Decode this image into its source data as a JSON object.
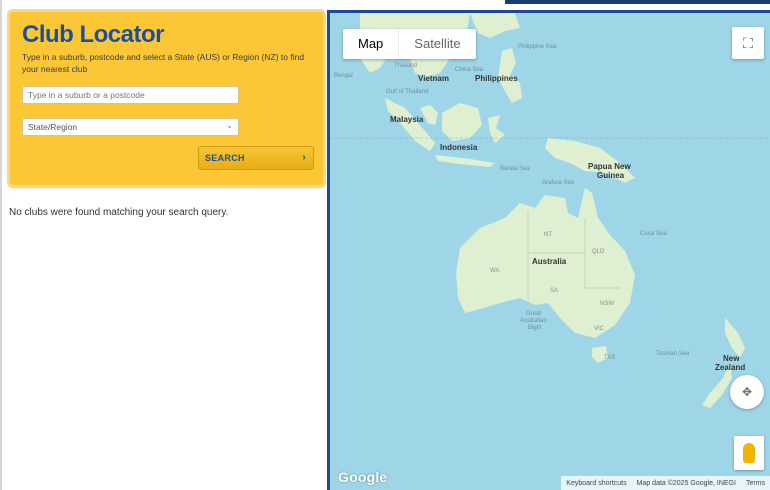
{
  "locator": {
    "title": "Club Locator",
    "description": "Type in a suburb, postcode and select a State (AUS) or Region (NZ) to find your nearest club",
    "search_placeholder": "Type in a suburb or a postcode",
    "state_select_value": "State/Region",
    "search_button_label": "SEARCH"
  },
  "results": {
    "message": "No clubs were found matching your search query."
  },
  "map": {
    "type_options": [
      "Map",
      "Satellite"
    ],
    "selected_type": "Map",
    "footer": {
      "shortcuts": "Keyboard shortcuts",
      "attribution": "Map data ©2025 Google, INEGI",
      "terms": "Terms"
    },
    "logo_text": "Google",
    "labels": {
      "philippine_sea": "Philippine Sea",
      "thailand": "Thailand",
      "bengal": "Bengal",
      "china_sea": "China Sea",
      "vietnam": "Vietnam",
      "philippines": "Philippines",
      "gulf_thailand": "Gulf of Thailand",
      "malaysia": "Malaysia",
      "indonesia": "Indonesia",
      "banda_sea": "Banda Sea",
      "arafura_sea": "Arafura Sea",
      "papua_new_guinea_1": "Papua New",
      "papua_new_guinea_2": "Guinea",
      "coral_sea": "Coral Sea",
      "nt": "NT",
      "qld": "QLD",
      "wa": "WA",
      "australia": "Australia",
      "sa": "SA",
      "nsw": "NSW",
      "great_australian_bight_1": "Great",
      "great_australian_bight_2": "Australian",
      "great_australian_bight_3": "Bight",
      "vic": "VIC",
      "tas": "TAS",
      "tasman_sea": "Tasman Sea",
      "new_zealand_1": "New",
      "new_zealand_2": "Zealand"
    }
  },
  "colors": {
    "panel": "#fcc737",
    "title": "#1d4f9c",
    "map_border": "#1d4b92",
    "water": "#9ed6e8",
    "land": "#dff0d2"
  },
  "icons": {
    "fullscreen": "fullscreen-icon",
    "camera": "camera-control-icon",
    "pegman": "pegman-icon",
    "dropdown": "chevron-down-icon",
    "arrow": "chevron-right-icon"
  }
}
